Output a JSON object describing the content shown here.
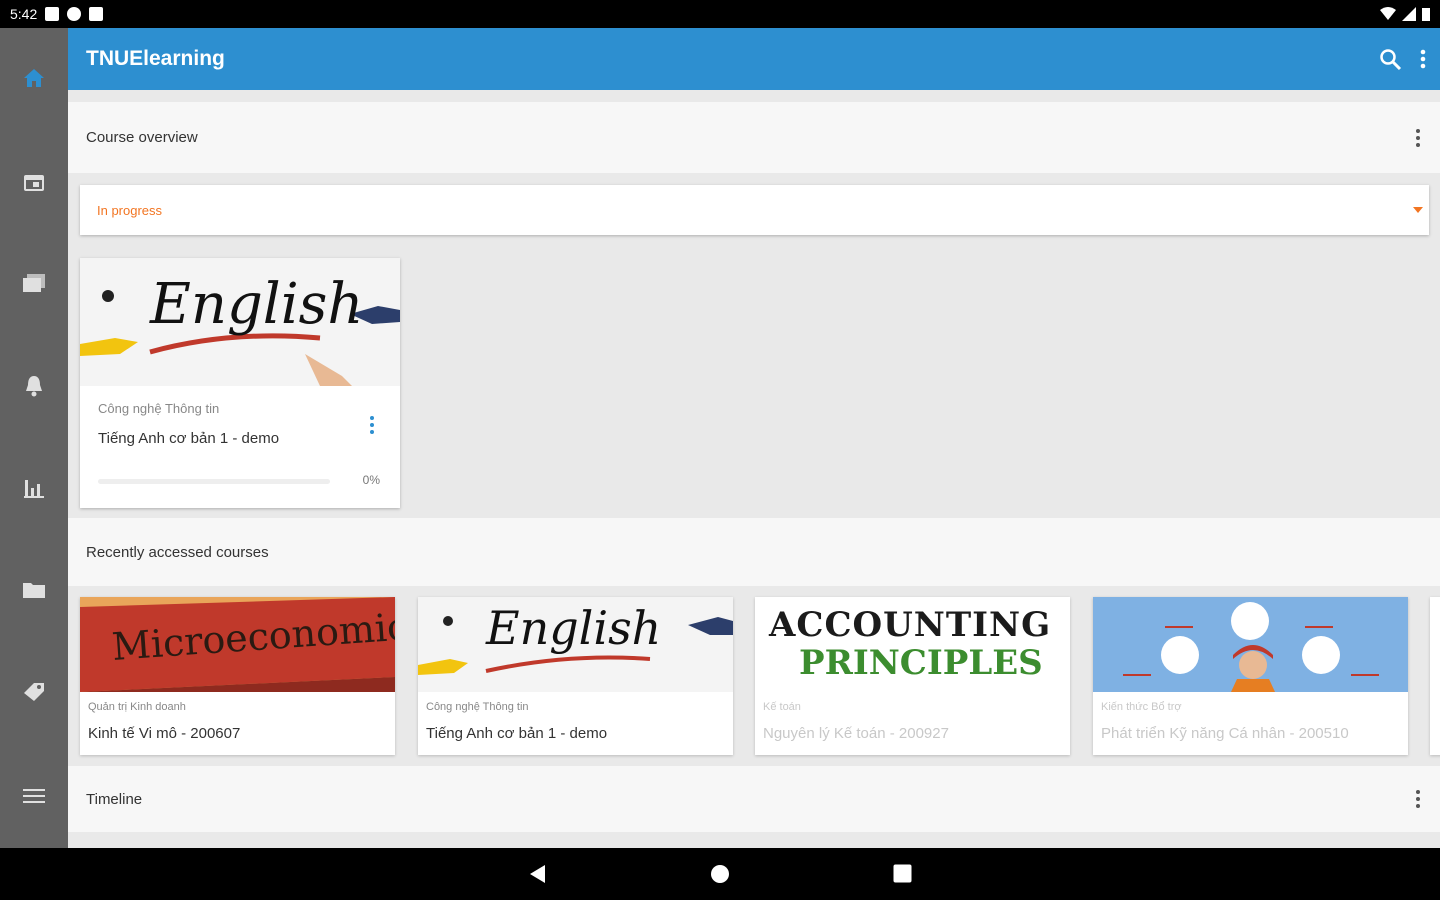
{
  "status_bar": {
    "time": "5:42"
  },
  "app": {
    "title": "TNUElearning"
  },
  "icons": {
    "home": "home-icon",
    "calendar": "calendar-icon",
    "messages": "messages-icon",
    "notifications": "bell-icon",
    "grades": "grades-icon",
    "files": "folder-icon",
    "badges": "tag-icon",
    "menu": "menu-icon",
    "search": "search-icon",
    "more": "more-vert-icon"
  },
  "colors": {
    "app_bar": "#2d8fd0",
    "nav_rail": "#616161",
    "accent": "#f27522",
    "active_nav": "#2d8fd0"
  },
  "course_overview": {
    "title": "Course overview",
    "filter_selected": "In progress",
    "courses": [
      {
        "image_text": "English",
        "category": "Công nghệ Thông tin",
        "name": "Tiếng Anh cơ bản 1 - demo",
        "progress": 0,
        "progress_label": "0%"
      }
    ]
  },
  "recent": {
    "title": "Recently accessed courses",
    "courses": [
      {
        "image_text": "Microeconomics",
        "category": "Quản trị Kinh doanh",
        "name": "Kinh tế Vi mô - 200607"
      },
      {
        "image_text": "English",
        "category": "Công nghệ Thông tin",
        "name": "Tiếng Anh cơ bản 1 - demo"
      },
      {
        "image_text_line1": "ACCOUNTING",
        "image_text_line2": "PRINCIPLES",
        "category": "Kế toán",
        "name": "Nguyên lý Kế toán - 200927"
      },
      {
        "category": "Kiến thức Bổ trợ",
        "name": "Phát triển Kỹ năng Cá nhân - 200510"
      }
    ]
  },
  "timeline": {
    "title": "Timeline"
  }
}
